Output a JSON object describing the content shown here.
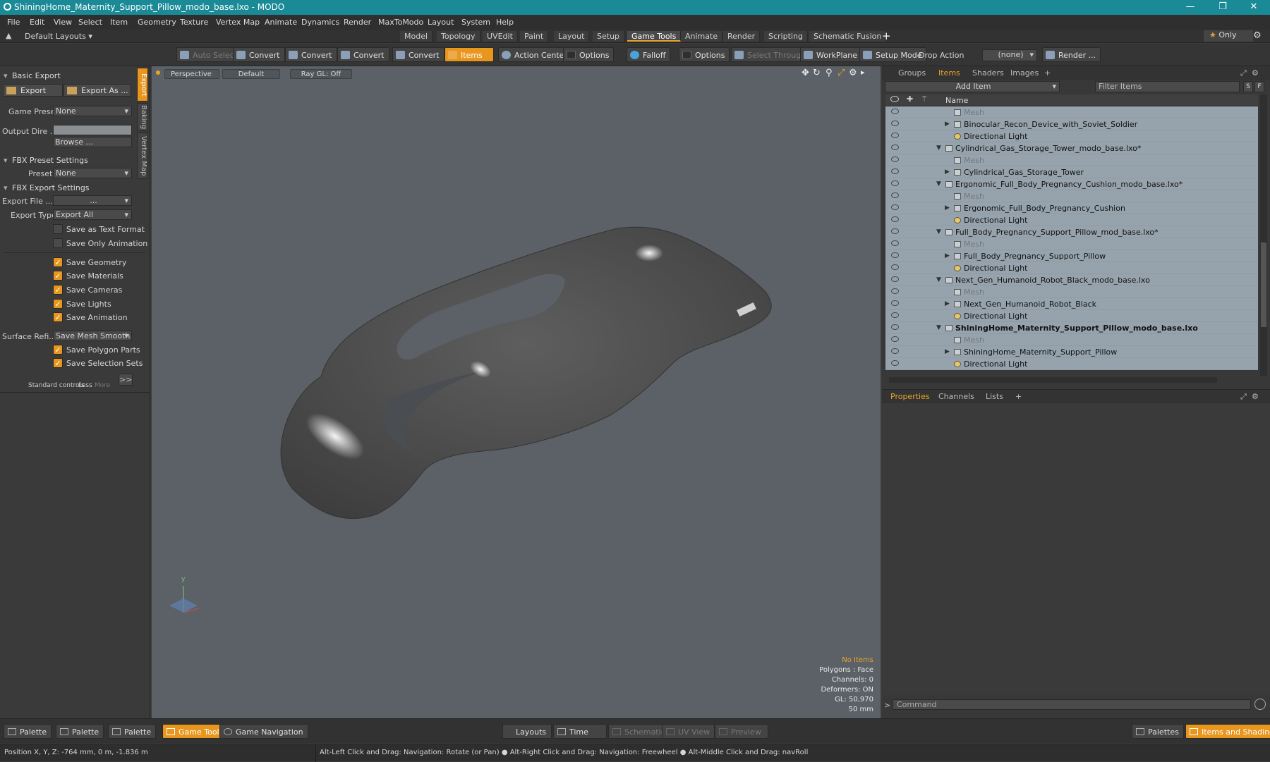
{
  "window": {
    "title": "ShiningHome_Maternity_Support_Pillow_modo_base.lxo - MODO"
  },
  "menu": [
    "File",
    "Edit",
    "View",
    "Select",
    "Item",
    "Geometry",
    "Texture",
    "Vertex Map",
    "Animate",
    "Dynamics",
    "Render",
    "MaxToModo",
    "Layout",
    "System",
    "Help"
  ],
  "layouts": {
    "default_label": "Default Layouts",
    "tabs": [
      "Model",
      "Topology",
      "UVEdit",
      "Paint",
      "Layout",
      "Setup",
      "Game Tools",
      "Animate",
      "Render",
      "Scripting",
      "Schematic Fusion"
    ],
    "active": "Game Tools",
    "only_label": "Only"
  },
  "toolbar": {
    "auto_select": "Auto Select",
    "convert": "Convert",
    "items": "Items",
    "action_center": "Action Center",
    "options": "Options",
    "falloff": "Falloff",
    "select_through": "Select Through",
    "workplane": "WorkPlane",
    "setup_mode": "Setup Mode",
    "drop_action": "Drop Action",
    "drop_value": "(none)",
    "render": "Render ..."
  },
  "left": {
    "basic_export": "Basic Export",
    "export_btn": "Export",
    "export_as_btn": "Export As ...",
    "game_preset_label": "Game Preset",
    "game_preset_value": "None",
    "output_dir_label": "Output Dire ...",
    "browse": "Browse ...",
    "fbx_preset": "FBX Preset Settings",
    "preset_label": "Preset",
    "preset_value": "None",
    "fbx_export": "FBX Export Settings",
    "export_file_label": "Export File ...",
    "export_file_value": "...",
    "export_type_label": "Export Type",
    "export_type_value": "Export All",
    "cb_text_format": "Save as Text Format",
    "cb_only_anim": "Save Only Animation",
    "cb_geometry": "Save Geometry",
    "cb_materials": "Save Materials",
    "cb_cameras": "Save Cameras",
    "cb_lights": "Save Lights",
    "cb_animation": "Save Animation",
    "surface_label": "Surface Refi...",
    "surface_value": "Save Mesh Smooth...",
    "cb_polyparts": "Save Polygon Parts",
    "cb_selsets": "Save Selection Sets",
    "standard_controls": "Standard controls",
    "less": "Less",
    "more": "More",
    "side_tabs": [
      "Export",
      "Baking",
      "Vertex Map"
    ]
  },
  "viewport": {
    "tab_perspective": "Perspective",
    "tab_default": "Default",
    "tab_raygl": "Ray GL: Off",
    "info": [
      "No Items",
      "Polygons : Face",
      "Channels: 0",
      "Deformers: ON",
      "GL: 50,970",
      "50 mm"
    ],
    "axis_y": "y"
  },
  "items_panel": {
    "tabs": [
      "Groups",
      "Items",
      "Shaders",
      "Images"
    ],
    "active_tab": "Items",
    "add_item": "Add Item",
    "filter": "Filter Items",
    "col_name": "Name",
    "rows": [
      {
        "name": "Mesh",
        "indent": 3,
        "type": "mesh",
        "gray": true
      },
      {
        "name": "Binocular_Recon_Device_with_Soviet_Soldier",
        "indent": 3,
        "type": "group"
      },
      {
        "name": "Directional Light",
        "indent": 3,
        "type": "light"
      },
      {
        "name": "Cylindrical_Gas_Storage_Tower_modo_base.lxo*",
        "indent": 2,
        "type": "scene"
      },
      {
        "name": "Mesh",
        "indent": 3,
        "type": "mesh",
        "gray": true
      },
      {
        "name": "Cylindrical_Gas_Storage_Tower",
        "indent": 3,
        "type": "group"
      },
      {
        "name": "Ergonomic_Full_Body_Pregnancy_Cushion_modo_base.lxo*",
        "indent": 2,
        "type": "scene"
      },
      {
        "name": "Mesh",
        "indent": 3,
        "type": "mesh",
        "gray": true
      },
      {
        "name": "Ergonomic_Full_Body_Pregnancy_Cushion",
        "indent": 3,
        "type": "group"
      },
      {
        "name": "Directional Light",
        "indent": 3,
        "type": "light"
      },
      {
        "name": "Full_Body_Pregnancy_Support_Pillow_mod_base.lxo*",
        "indent": 2,
        "type": "scene"
      },
      {
        "name": "Mesh",
        "indent": 3,
        "type": "mesh",
        "gray": true
      },
      {
        "name": "Full_Body_Pregnancy_Support_Pillow",
        "indent": 3,
        "type": "group"
      },
      {
        "name": "Directional Light",
        "indent": 3,
        "type": "light"
      },
      {
        "name": "Next_Gen_Humanoid_Robot_Black_modo_base.lxo",
        "indent": 2,
        "type": "scene"
      },
      {
        "name": "Mesh",
        "indent": 3,
        "type": "mesh",
        "gray": true
      },
      {
        "name": "Next_Gen_Humanoid_Robot_Black",
        "indent": 3,
        "type": "group"
      },
      {
        "name": "Directional Light",
        "indent": 3,
        "type": "light"
      },
      {
        "name": "ShiningHome_Maternity_Support_Pillow_modo_base.lxo",
        "indent": 2,
        "type": "scene",
        "bold": true
      },
      {
        "name": "Mesh",
        "indent": 3,
        "type": "mesh",
        "gray": true
      },
      {
        "name": "ShiningHome_Maternity_Support_Pillow",
        "indent": 3,
        "type": "group"
      },
      {
        "name": "Directional Light",
        "indent": 3,
        "type": "light"
      }
    ]
  },
  "props_panel": {
    "tabs": [
      "Properties",
      "Channels",
      "Lists"
    ],
    "active": "Properties",
    "command_placeholder": "Command"
  },
  "bottombar": {
    "left": [
      "Palette",
      "Palette",
      "Palette",
      "Game Tools",
      "Game Navigation"
    ],
    "center": [
      "Layouts",
      "Time",
      "Schematic",
      "UV View",
      "Preview"
    ],
    "right": [
      "Palettes",
      "Items and Shading"
    ]
  },
  "status": {
    "position": "Position X, Y, Z:  -764 mm, 0 m, -1.836 m",
    "hint": "Alt-Left Click and Drag: Navigation: Rotate (or Pan) ● Alt-Right Click and Drag: Navigation: Freewheel ● Alt-Middle Click and Drag: navRoll"
  },
  "colors": {
    "accent": "#e8961e",
    "titlebar": "#1a8a96",
    "viewport": "#5b6167",
    "selected_rows": "#96a3ac"
  }
}
